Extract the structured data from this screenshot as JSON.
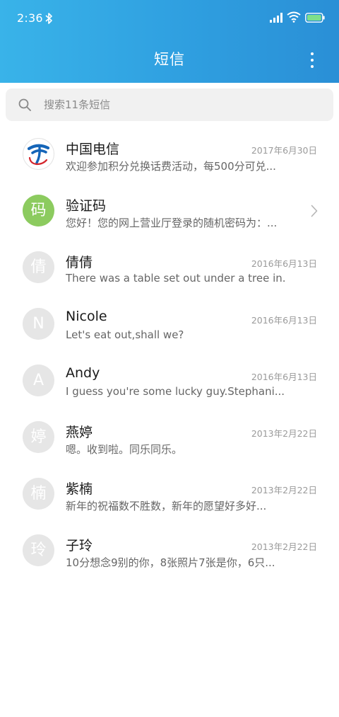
{
  "status_bar": {
    "time": "2:36"
  },
  "header": {
    "title": "短信"
  },
  "search": {
    "placeholder": "搜索11条短信"
  },
  "colors": {
    "header_start": "#39b3e9",
    "header_end": "#2a8fd6",
    "avatar_green": "#8ccb5f",
    "avatar_gray": "#e6e6e6"
  },
  "conversations": [
    {
      "name": "中国电信",
      "preview": "欢迎参加积分兑换话费活动，每500分可兑...",
      "date": "2017年6月30日",
      "avatar": "",
      "avatar_icon": "china-telecom-logo"
    },
    {
      "name": "验证码",
      "preview": "您好！您的网上营业厅登录的随机密码为：...",
      "date": "",
      "avatar": "码",
      "avatar_icon": "chevron-right-icon"
    },
    {
      "name": "倩倩",
      "preview": "There was a table set out under a tree in...",
      "date": "2016年6月13日",
      "avatar": "倩"
    },
    {
      "name": "Nicole",
      "preview": "Let's eat out,shall we?",
      "date": "2016年6月13日",
      "avatar": "N"
    },
    {
      "name": "Andy",
      "preview": "I guess you're some lucky guy.Stephani...",
      "date": "2016年6月13日",
      "avatar": "A"
    },
    {
      "name": "燕婷",
      "preview": "嗯。收到啦。同乐同乐。",
      "date": "2013年2月22日",
      "avatar": "婷"
    },
    {
      "name": "紫楠",
      "preview": "新年的祝福数不胜数，新年的愿望好多好...",
      "date": "2013年2月22日",
      "avatar": "楠"
    },
    {
      "name": "子玲",
      "preview": "10分想念9别的你，8张照片7张是你，6只...",
      "date": "2013年2月22日",
      "avatar": "玲"
    }
  ]
}
